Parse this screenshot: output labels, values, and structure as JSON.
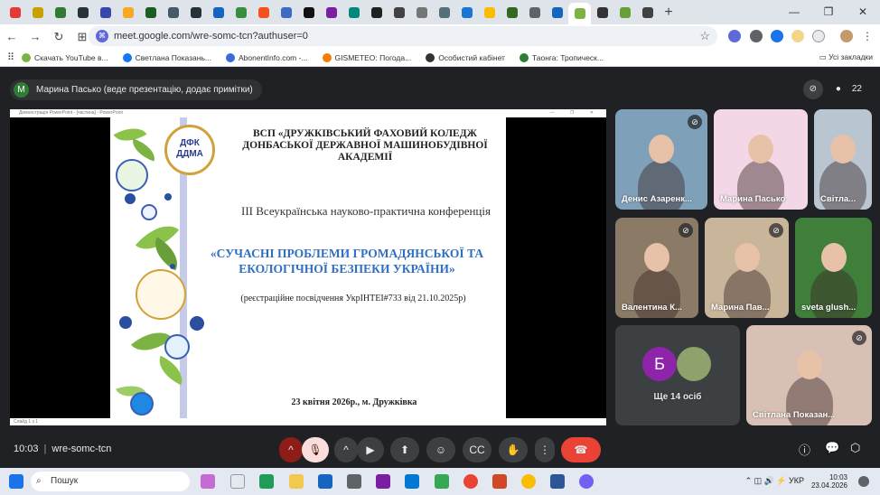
{
  "browser": {
    "url": "meet.google.com/wre-somc-tcn?authuser=0",
    "bookmarks": [
      {
        "label": "Скачать YouTube в...",
        "color": "#7cb342"
      },
      {
        "label": "Светлана Показань...",
        "color": "#1877f2"
      },
      {
        "label": "AbonentInfo.com -...",
        "color": "#3b6bd6"
      },
      {
        "label": "GISMETEO: Погода...",
        "color": "#f57c00"
      },
      {
        "label": "Особистий кабінет",
        "color": "#333333"
      },
      {
        "label": "Таонга: Тропическ...",
        "color": "#2e7d32"
      }
    ],
    "all_bookmarks": "Усі закладки",
    "tab_count": 31,
    "tabs_color": [
      "#e53935",
      "#c8a200",
      "#2e7d32",
      "#263238",
      "#3949ab",
      "#f9a825",
      "#1b5e20",
      "#455a64",
      "#263238",
      "#1565c0",
      "#388e3c",
      "#f4511e",
      "#3d6bc4",
      "#111111",
      "#7b1fa2",
      "#00897b",
      "#212121",
      "#424242",
      "#757575",
      "#546e7a",
      "#1976d2",
      "#fbbc04",
      "#33691e",
      "#5f6368",
      "#1565c0",
      "#7cb342",
      "#333333",
      "#689f38",
      "#424242"
    ]
  },
  "meet": {
    "presenter_initial": "М",
    "presenter_text": "Марина Пасько (веде презентацію, додає примітки)",
    "participant_count": "22",
    "time": "10:03",
    "meeting_code": "wre-somc-tcn"
  },
  "slide": {
    "ppt_title": "Демонстрація PowerPoint - [частина] - PowerPoint",
    "status": "Слайд 1 з 1",
    "logo": "ДФК\nДДМА",
    "institution": "ВСП «ДРУЖКІВСЬКИЙ ФАХОВИЙ КОЛЕДЖ ДОНБАСЬКОЇ ДЕРЖАВНОЇ МАШИНОБУДІВНОЇ АКАДЕМІЇ",
    "conference": "ІІІ Всеукраїнська науково-практична конференція",
    "topic": "«СУЧАСНІ ПРОБЛЕМИ ГРОМАДЯНСЬКОЇ ТА ЕКОЛОГІЧНОЇ БЕЗПЕКИ УКРАЇНИ»",
    "registration": "(реєстраційне посвідчення УкрІНТЕІ#733  від 21.10.2025р)",
    "date_place": "23 квітня 2026р., м. Дружківка"
  },
  "participants": [
    {
      "name": "Денис Азаренк...",
      "muted": true,
      "bg": "#7ea0b8"
    },
    {
      "name": "Марина Пасько",
      "muted": false,
      "bg": "#f3d7e6"
    },
    {
      "name": "Світла...",
      "muted": false,
      "bg": "#b9c6d2"
    },
    {
      "name": "Валентина К...",
      "muted": true,
      "bg": "#8a7a66"
    },
    {
      "name": "Марина Пав...",
      "muted": true,
      "bg": "#c9b59a"
    },
    {
      "name": "sveta glush...",
      "muted": false,
      "bg": "#3f7f3a"
    },
    {
      "name": "Ще 14 осіб",
      "initial": "Б",
      "bg": "#3c4043"
    },
    {
      "name": "Світлана Показан...",
      "muted": true,
      "bg": "#d9c0b5"
    }
  ],
  "taskbar": {
    "search": "Пошук",
    "lang": "УКР",
    "clock_time": "10:03",
    "clock_date": "23.04.2026"
  }
}
